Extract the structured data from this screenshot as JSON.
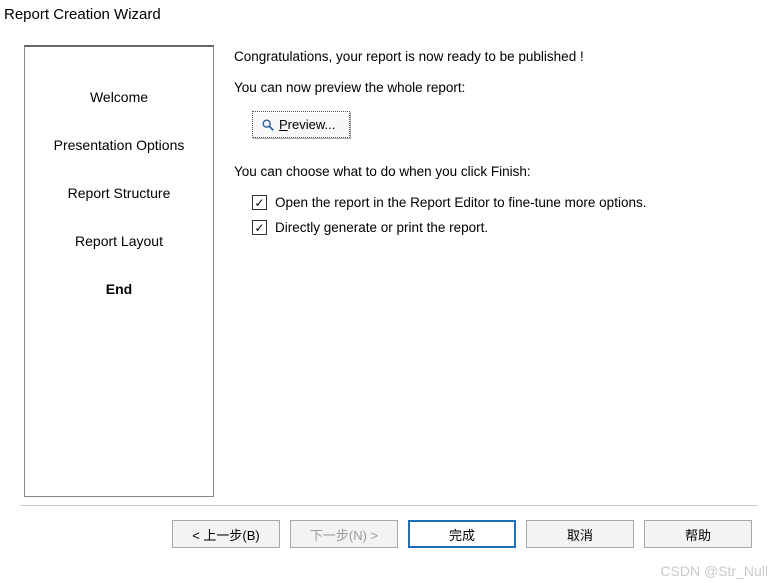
{
  "window": {
    "title": "Report Creation Wizard"
  },
  "sidebar": {
    "items": [
      {
        "label": "Welcome",
        "active": false
      },
      {
        "label": "Presentation Options",
        "active": false
      },
      {
        "label": "Report Structure",
        "active": false
      },
      {
        "label": "Report Layout",
        "active": false
      },
      {
        "label": "End",
        "active": true
      }
    ]
  },
  "main": {
    "congrats": "Congratulations, your report is now ready to be published !",
    "preview_intro": "You can now preview the whole report:",
    "preview_button_prefix": "P",
    "preview_button_rest": "review...",
    "finish_intro": "You can choose what to do when you click Finish:",
    "options": [
      {
        "label": "Open the report in the Report Editor to fine-tune more options.",
        "checked": true
      },
      {
        "label": "Directly generate or print the report.",
        "checked": true
      }
    ]
  },
  "buttons": {
    "back": "< 上一步(B)",
    "next": "下一步(N) >",
    "finish": "完成",
    "cancel": "取消",
    "help": "帮助"
  },
  "watermark": "CSDN @Str_Null"
}
